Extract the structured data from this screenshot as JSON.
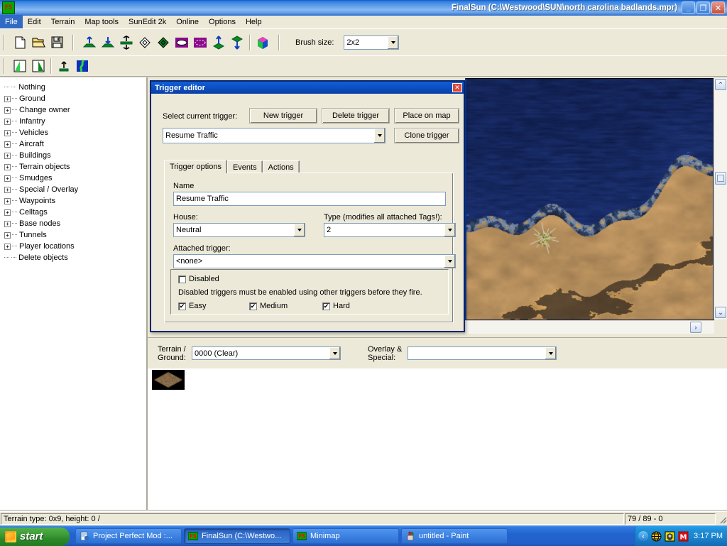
{
  "window": {
    "title": "FinalSun (C:\\Westwood\\SUN\\north carolina badlands.mpr)",
    "app_icon": "FS",
    "minimize": "_",
    "maximize": "❐",
    "close": "✕"
  },
  "menubar": {
    "items": [
      {
        "label": "File",
        "active": true
      },
      {
        "label": "Edit",
        "active": false
      },
      {
        "label": "Terrain",
        "active": false
      },
      {
        "label": "Map tools",
        "active": false
      },
      {
        "label": "SunEdit 2k",
        "active": false
      },
      {
        "label": "Online",
        "active": false
      },
      {
        "label": "Options",
        "active": false
      },
      {
        "label": "Help",
        "active": false
      }
    ]
  },
  "toolbar": {
    "file_icons": [
      "new-document-icon",
      "open-folder-icon",
      "save-disk-icon"
    ],
    "terrain_icons": [
      "raise-ground-icon",
      "lower-ground-icon",
      "flatten-ground-icon",
      "tile-outline-icon",
      "tile-filled-icon",
      "ellipse-outline-icon",
      "ellipse-dotted-icon",
      "raise-tile-icon",
      "lower-tile-icon",
      "cube-color-icon"
    ],
    "brush_label": "Brush size:",
    "brush_value": "2x2"
  },
  "toolbar2": {
    "icons": [
      "slope-left-icon",
      "slope-right-icon",
      "height-tool-icon",
      "river-tool-icon"
    ]
  },
  "sidebar": {
    "items": [
      {
        "label": "Nothing",
        "expandable": false
      },
      {
        "label": "Ground",
        "expandable": true
      },
      {
        "label": "Change owner",
        "expandable": true
      },
      {
        "label": "Infantry",
        "expandable": true
      },
      {
        "label": "Vehicles",
        "expandable": true
      },
      {
        "label": "Aircraft",
        "expandable": true
      },
      {
        "label": "Buildings",
        "expandable": true
      },
      {
        "label": "Terrain objects",
        "expandable": true
      },
      {
        "label": "Smudges",
        "expandable": true
      },
      {
        "label": "Special / Overlay",
        "expandable": true
      },
      {
        "label": "Waypoints",
        "expandable": true
      },
      {
        "label": "Celltags",
        "expandable": true
      },
      {
        "label": "Base nodes",
        "expandable": true
      },
      {
        "label": "Tunnels",
        "expandable": true
      },
      {
        "label": "Player locations",
        "expandable": true
      },
      {
        "label": "Delete objects",
        "expandable": false
      }
    ]
  },
  "dialog": {
    "title": "Trigger editor",
    "close_label": "✕",
    "select_label": "Select current trigger:",
    "buttons": {
      "new_trigger": "New trigger",
      "delete_trigger": "Delete trigger",
      "place_on_map": "Place on map",
      "clone_trigger": "Clone trigger"
    },
    "current_trigger": "Resume Traffic",
    "tabs": [
      {
        "label": "Trigger options",
        "selected": true
      },
      {
        "label": "Events",
        "selected": false
      },
      {
        "label": "Actions",
        "selected": false
      }
    ],
    "fields": {
      "name_label": "Name",
      "name_value": "Resume Traffic",
      "house_label": "House:",
      "house_value": "Neutral",
      "type_label": "Type (modifies all attached Tags!):",
      "type_value": "2",
      "attached_label": "Attached trigger:",
      "attached_value": "<none>"
    },
    "disabled": {
      "checkbox_label": "Disabled",
      "checked": false,
      "hint": "Disabled triggers must be enabled using other triggers before they fire."
    },
    "difficulty": [
      {
        "label": "Easy",
        "checked": true
      },
      {
        "label": "Medium",
        "checked": true
      },
      {
        "label": "Hard",
        "checked": true
      }
    ]
  },
  "tilebar": {
    "terrain_label_line1": "Terrain /",
    "terrain_label_line2": "Ground:",
    "terrain_value": "0000 (Clear)",
    "overlay_label_line1": "Overlay &",
    "overlay_label_line2": "Special:",
    "overlay_value": ""
  },
  "statusbar": {
    "left": "Terrain type: 0x9, height: 0 /",
    "right": "79 / 89 - 0"
  },
  "taskbar": {
    "start_label": "start",
    "tasks": [
      {
        "label": "Project Perfect Mod :...",
        "icon": "internet-explorer-icon",
        "active": false
      },
      {
        "label": "FinalSun (C:\\Westwo...",
        "icon": "finalsun-icon",
        "active": true
      },
      {
        "label": "Minimap",
        "icon": "finalsun-icon",
        "active": false
      },
      {
        "label": "untitled - Paint",
        "icon": "paint-icon",
        "active": false
      }
    ],
    "tray": {
      "expand": "‹",
      "icons": [
        "network-globe-icon",
        "shield-icon",
        "mcafee-m-icon"
      ],
      "clock": "3:17 PM"
    }
  },
  "colors": {
    "title_blue": "#2f7ce0",
    "dialog_blue": "#0a3fa8",
    "face": "#ece9d8",
    "taskbar_blue": "#2264cf",
    "start_green": "#3d9a36",
    "water": "#16243f",
    "sand": "#b08a55"
  }
}
